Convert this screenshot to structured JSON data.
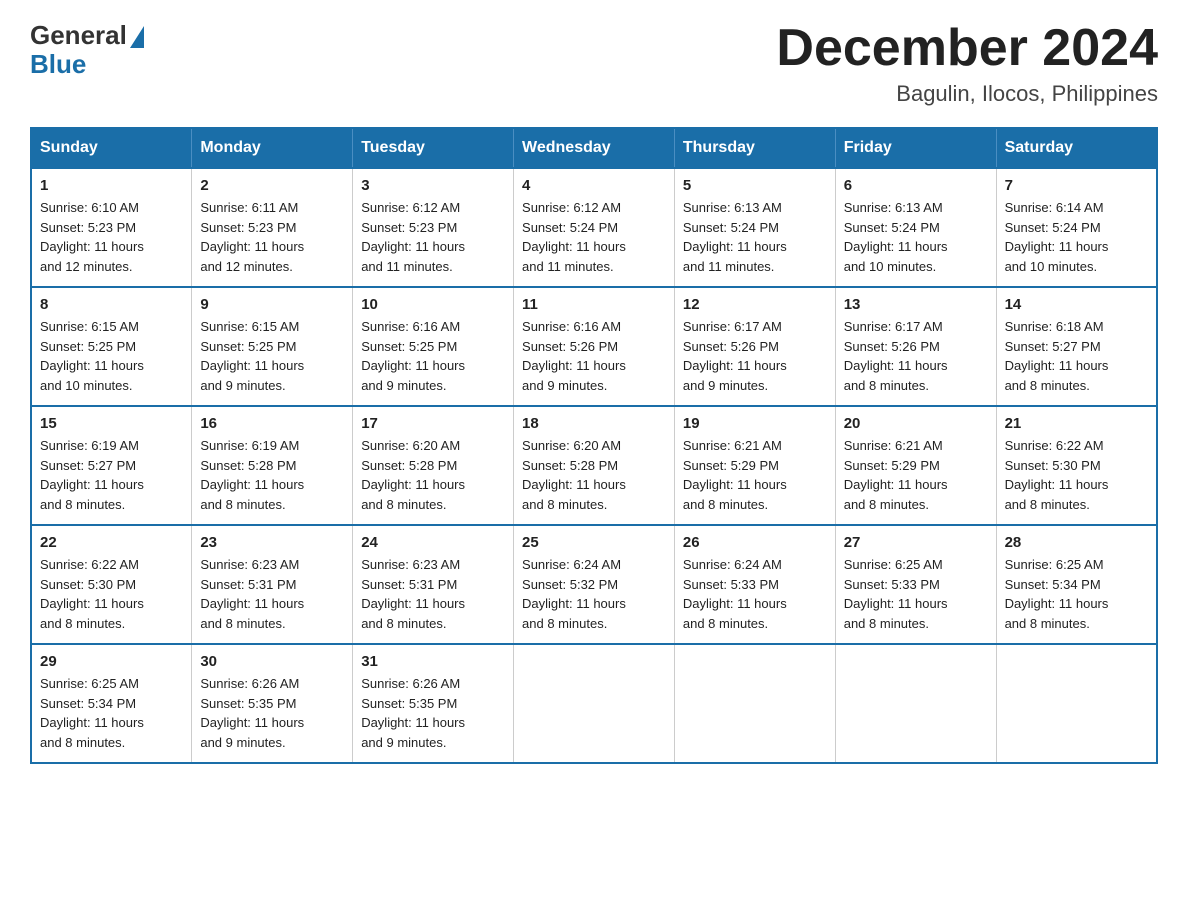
{
  "logo": {
    "general": "General",
    "blue": "Blue"
  },
  "title": "December 2024",
  "location": "Bagulin, Ilocos, Philippines",
  "weekdays": [
    "Sunday",
    "Monday",
    "Tuesday",
    "Wednesday",
    "Thursday",
    "Friday",
    "Saturday"
  ],
  "weeks": [
    [
      {
        "day": "1",
        "sunrise": "6:10 AM",
        "sunset": "5:23 PM",
        "daylight": "11 hours and 12 minutes."
      },
      {
        "day": "2",
        "sunrise": "6:11 AM",
        "sunset": "5:23 PM",
        "daylight": "11 hours and 12 minutes."
      },
      {
        "day": "3",
        "sunrise": "6:12 AM",
        "sunset": "5:23 PM",
        "daylight": "11 hours and 11 minutes."
      },
      {
        "day": "4",
        "sunrise": "6:12 AM",
        "sunset": "5:24 PM",
        "daylight": "11 hours and 11 minutes."
      },
      {
        "day": "5",
        "sunrise": "6:13 AM",
        "sunset": "5:24 PM",
        "daylight": "11 hours and 11 minutes."
      },
      {
        "day": "6",
        "sunrise": "6:13 AM",
        "sunset": "5:24 PM",
        "daylight": "11 hours and 10 minutes."
      },
      {
        "day": "7",
        "sunrise": "6:14 AM",
        "sunset": "5:24 PM",
        "daylight": "11 hours and 10 minutes."
      }
    ],
    [
      {
        "day": "8",
        "sunrise": "6:15 AM",
        "sunset": "5:25 PM",
        "daylight": "11 hours and 10 minutes."
      },
      {
        "day": "9",
        "sunrise": "6:15 AM",
        "sunset": "5:25 PM",
        "daylight": "11 hours and 9 minutes."
      },
      {
        "day": "10",
        "sunrise": "6:16 AM",
        "sunset": "5:25 PM",
        "daylight": "11 hours and 9 minutes."
      },
      {
        "day": "11",
        "sunrise": "6:16 AM",
        "sunset": "5:26 PM",
        "daylight": "11 hours and 9 minutes."
      },
      {
        "day": "12",
        "sunrise": "6:17 AM",
        "sunset": "5:26 PM",
        "daylight": "11 hours and 9 minutes."
      },
      {
        "day": "13",
        "sunrise": "6:17 AM",
        "sunset": "5:26 PM",
        "daylight": "11 hours and 8 minutes."
      },
      {
        "day": "14",
        "sunrise": "6:18 AM",
        "sunset": "5:27 PM",
        "daylight": "11 hours and 8 minutes."
      }
    ],
    [
      {
        "day": "15",
        "sunrise": "6:19 AM",
        "sunset": "5:27 PM",
        "daylight": "11 hours and 8 minutes."
      },
      {
        "day": "16",
        "sunrise": "6:19 AM",
        "sunset": "5:28 PM",
        "daylight": "11 hours and 8 minutes."
      },
      {
        "day": "17",
        "sunrise": "6:20 AM",
        "sunset": "5:28 PM",
        "daylight": "11 hours and 8 minutes."
      },
      {
        "day": "18",
        "sunrise": "6:20 AM",
        "sunset": "5:28 PM",
        "daylight": "11 hours and 8 minutes."
      },
      {
        "day": "19",
        "sunrise": "6:21 AM",
        "sunset": "5:29 PM",
        "daylight": "11 hours and 8 minutes."
      },
      {
        "day": "20",
        "sunrise": "6:21 AM",
        "sunset": "5:29 PM",
        "daylight": "11 hours and 8 minutes."
      },
      {
        "day": "21",
        "sunrise": "6:22 AM",
        "sunset": "5:30 PM",
        "daylight": "11 hours and 8 minutes."
      }
    ],
    [
      {
        "day": "22",
        "sunrise": "6:22 AM",
        "sunset": "5:30 PM",
        "daylight": "11 hours and 8 minutes."
      },
      {
        "day": "23",
        "sunrise": "6:23 AM",
        "sunset": "5:31 PM",
        "daylight": "11 hours and 8 minutes."
      },
      {
        "day": "24",
        "sunrise": "6:23 AM",
        "sunset": "5:31 PM",
        "daylight": "11 hours and 8 minutes."
      },
      {
        "day": "25",
        "sunrise": "6:24 AM",
        "sunset": "5:32 PM",
        "daylight": "11 hours and 8 minutes."
      },
      {
        "day": "26",
        "sunrise": "6:24 AM",
        "sunset": "5:33 PM",
        "daylight": "11 hours and 8 minutes."
      },
      {
        "day": "27",
        "sunrise": "6:25 AM",
        "sunset": "5:33 PM",
        "daylight": "11 hours and 8 minutes."
      },
      {
        "day": "28",
        "sunrise": "6:25 AM",
        "sunset": "5:34 PM",
        "daylight": "11 hours and 8 minutes."
      }
    ],
    [
      {
        "day": "29",
        "sunrise": "6:25 AM",
        "sunset": "5:34 PM",
        "daylight": "11 hours and 8 minutes."
      },
      {
        "day": "30",
        "sunrise": "6:26 AM",
        "sunset": "5:35 PM",
        "daylight": "11 hours and 9 minutes."
      },
      {
        "day": "31",
        "sunrise": "6:26 AM",
        "sunset": "5:35 PM",
        "daylight": "11 hours and 9 minutes."
      },
      null,
      null,
      null,
      null
    ]
  ],
  "labels": {
    "sunrise": "Sunrise:",
    "sunset": "Sunset:",
    "daylight": "Daylight:"
  }
}
